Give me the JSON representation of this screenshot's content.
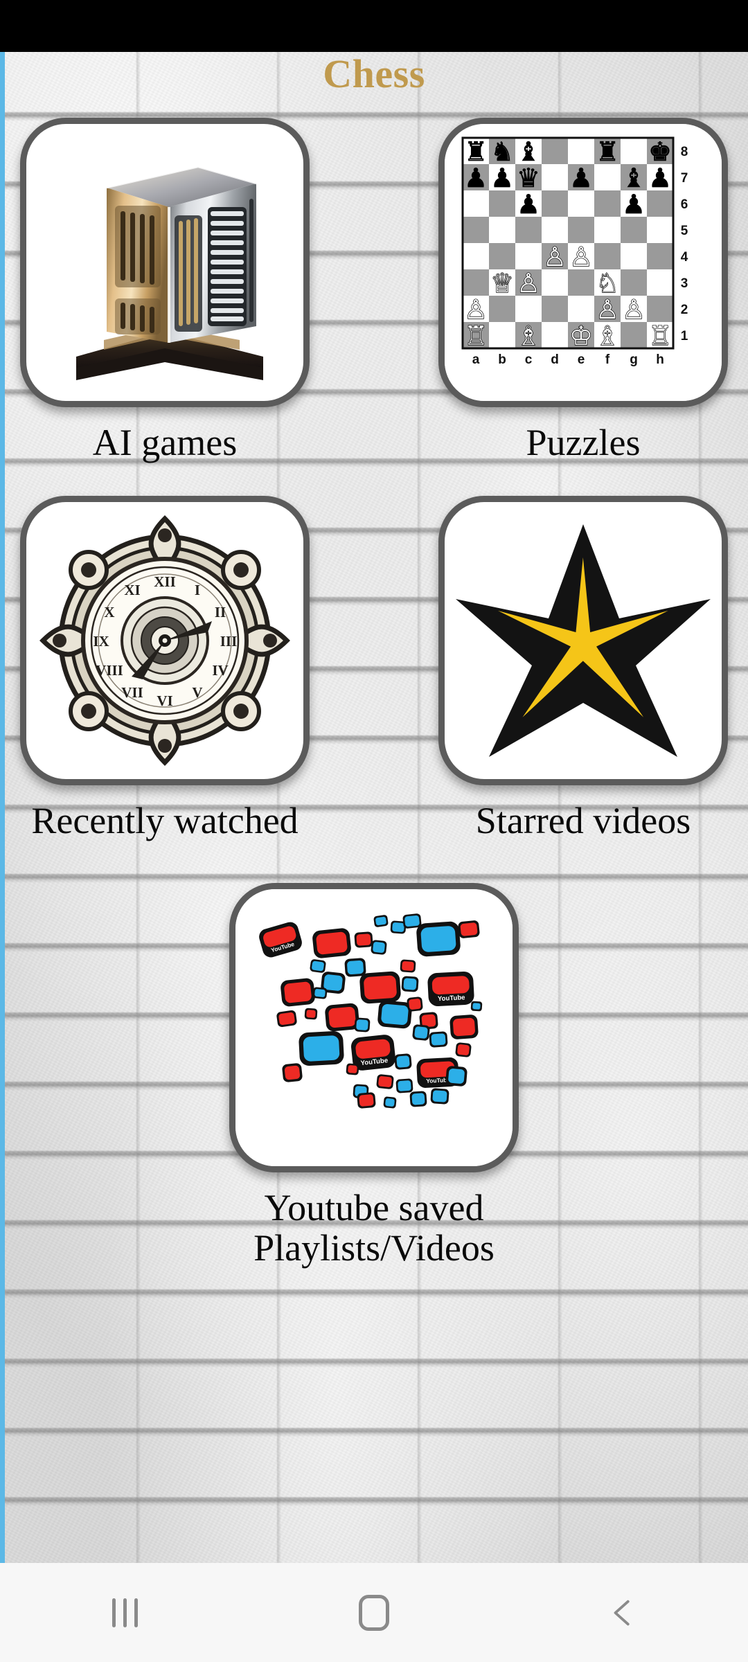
{
  "app": {
    "title": "Chess",
    "title_color": "#c09a4e",
    "background": "white-brick-wall",
    "label_color": "#0a0a0a",
    "tile_border_color": "#5b5b5b",
    "edge_accent_color": "#5cb8e6"
  },
  "grid": {
    "rows": [
      {
        "tiles": [
          {
            "label": "AI games",
            "icon": "server-tower-icon",
            "name": "tile-ai-games"
          },
          {
            "label": "Puzzles",
            "icon": "chessboard-icon",
            "name": "tile-puzzles"
          }
        ]
      },
      {
        "tiles": [
          {
            "label": "Recently watched",
            "icon": "ornate-clock-icon",
            "name": "tile-recently-watched"
          },
          {
            "label": "Starred videos",
            "icon": "star-icon",
            "name": "tile-starred-videos"
          }
        ]
      },
      {
        "tiles": [
          {
            "label": "Youtube saved Playlists/Videos",
            "icon": "youtube-collage-icon",
            "name": "tile-youtube-saved"
          }
        ]
      }
    ]
  },
  "chessboard": {
    "files": [
      "a",
      "b",
      "c",
      "d",
      "e",
      "f",
      "g",
      "h"
    ],
    "ranks": [
      "8",
      "7",
      "6",
      "5",
      "4",
      "3",
      "2",
      "1"
    ],
    "light_square": "#ffffff",
    "dark_square": "#9a9a9a",
    "position": [
      [
        "r",
        "n",
        "b",
        "",
        "",
        "r",
        "",
        "k"
      ],
      [
        "p",
        "p",
        "q",
        "",
        "p",
        "",
        "b",
        "p"
      ],
      [
        "",
        "",
        "p",
        "",
        "",
        "",
        "p",
        ""
      ],
      [
        "",
        "",
        "",
        "",
        "",
        "",
        "",
        ""
      ],
      [
        "",
        "",
        "",
        "P",
        "P",
        "",
        "",
        ""
      ],
      [
        "",
        "Q",
        "P",
        "",
        "",
        "N",
        "",
        ""
      ],
      [
        "P",
        "",
        "",
        "",
        "",
        "P",
        "P",
        ""
      ],
      [
        "R",
        "",
        "B",
        "",
        "K",
        "B",
        "",
        "R"
      ]
    ]
  },
  "star_icon": {
    "outer_color": "#141414",
    "inner_color": "#f5c518"
  },
  "server_icon": {
    "gold_color": "#c9a063",
    "silver_color": "#b9bcc0",
    "base_color": "#2a2018"
  },
  "youtube_icon": {
    "red": "#ee2a24",
    "blue": "#2cafe8",
    "outline": "#111111",
    "wordmark": "YouTube"
  },
  "nav_bar": {
    "background": "#f7f7f7",
    "icon_color": "#8a8a8a",
    "buttons": [
      {
        "name": "nav-recents-button",
        "icon": "recents-icon",
        "label": "Recents"
      },
      {
        "name": "nav-home-button",
        "icon": "home-icon",
        "label": "Home"
      },
      {
        "name": "nav-back-button",
        "icon": "back-chevron-icon",
        "label": "Back"
      }
    ]
  }
}
